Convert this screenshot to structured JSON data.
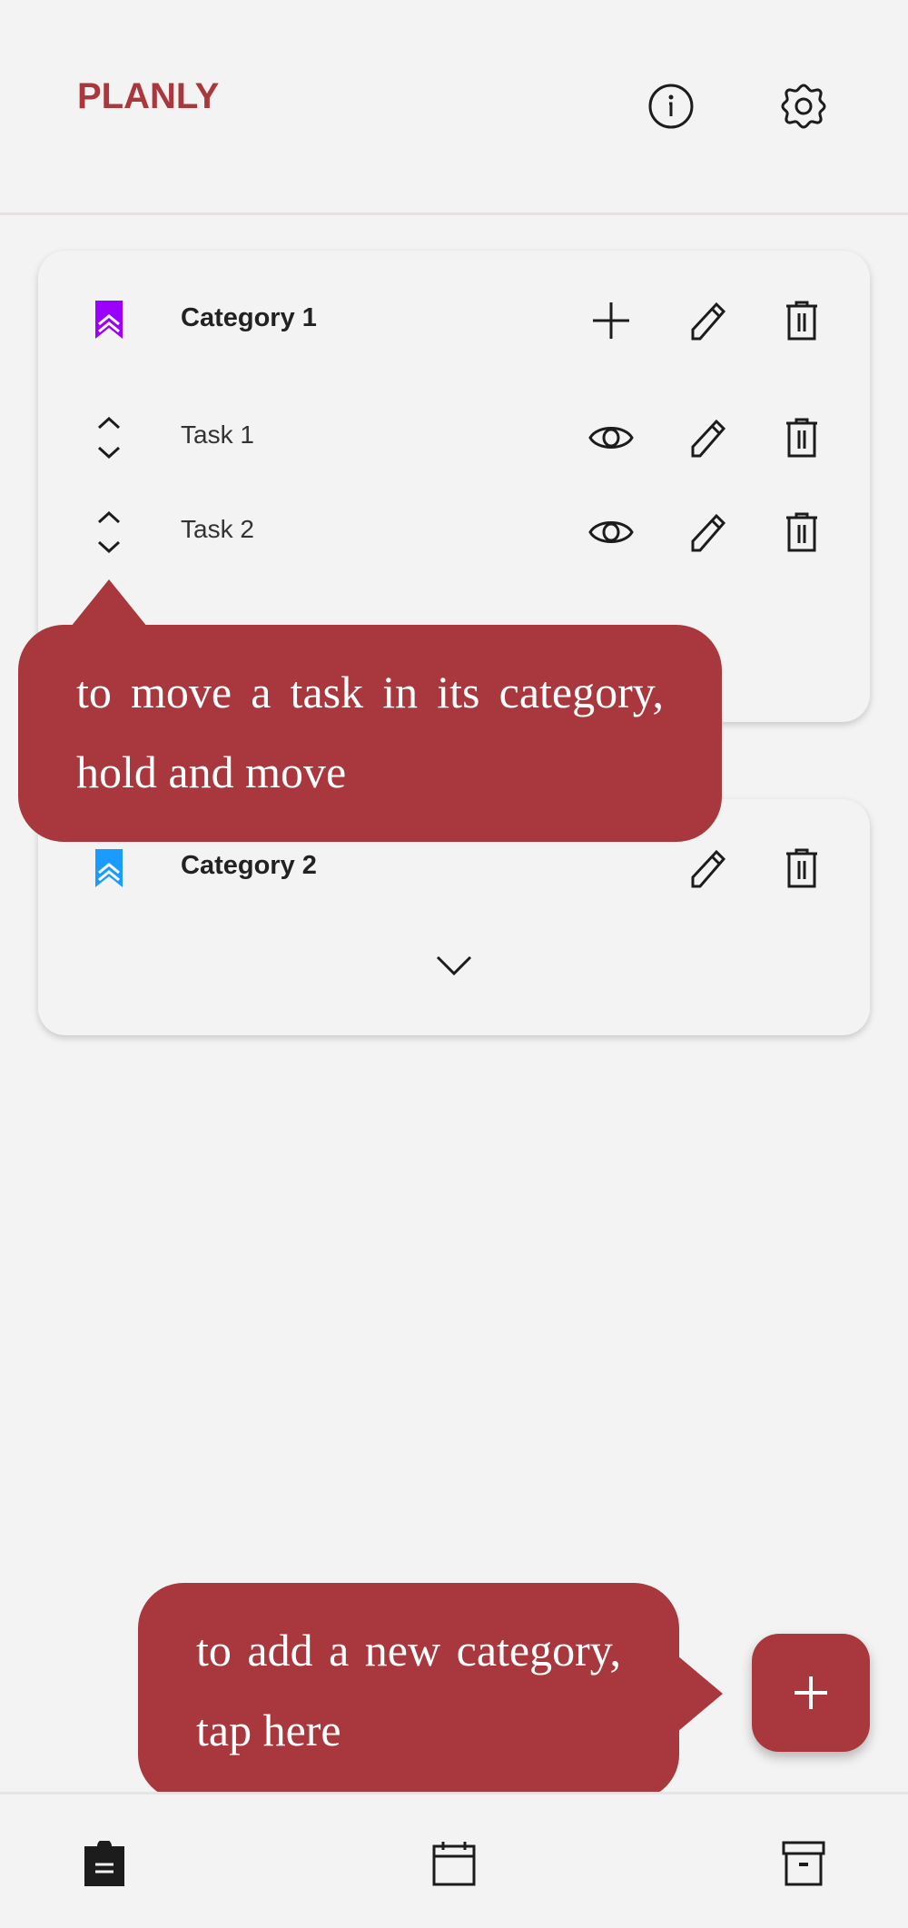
{
  "app": {
    "title": "PLANLY",
    "brand_color": "#a8383d"
  },
  "header": {
    "icons": [
      "info-icon",
      "gear-icon"
    ]
  },
  "categories": [
    {
      "label": "Category 1",
      "color": "#9b00ff",
      "expanded": true,
      "tasks": [
        {
          "label": "Task 1"
        },
        {
          "label": "Task 2"
        }
      ]
    },
    {
      "label": "Category 2",
      "color": "#1a9cff",
      "expanded": false
    }
  ],
  "tooltips": {
    "move_task": "to move a task in its category, hold and move",
    "add_category": "to add a new category, tap here"
  },
  "fab": {
    "label": "+"
  },
  "bottom_nav": {
    "items": [
      "tasks-clipboard-icon",
      "calendar-icon",
      "archive-icon"
    ],
    "active": 0
  }
}
